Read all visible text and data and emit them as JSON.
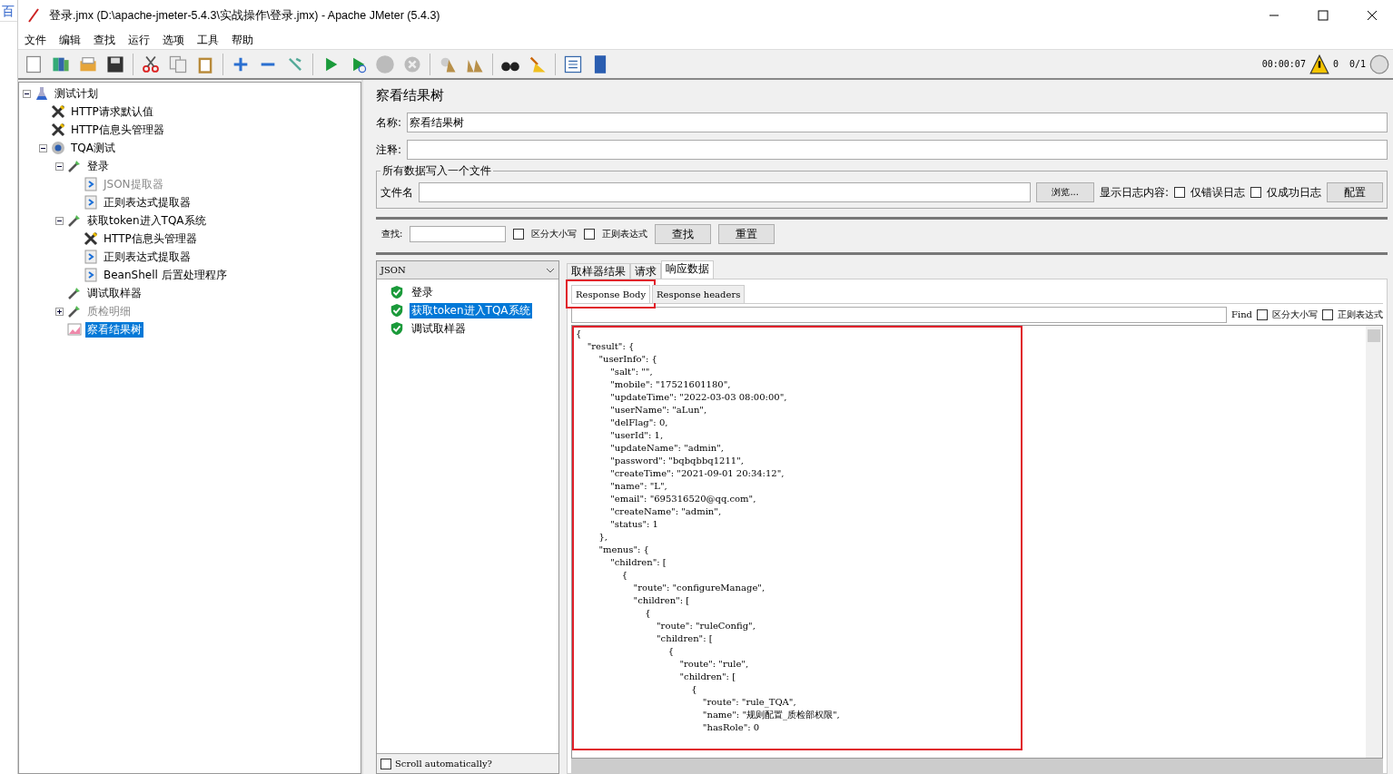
{
  "behind_window": {
    "text": "百"
  },
  "window": {
    "title": "登录.jmx (D:\\apache-jmeter-5.4.3\\实战操作\\登录.jmx) - Apache JMeter (5.4.3)"
  },
  "menu": [
    "文件",
    "编辑",
    "查找",
    "运行",
    "选项",
    "工具",
    "帮助"
  ],
  "status": {
    "elapsed": "00:00:07",
    "warnings": "0",
    "threads": "0/1"
  },
  "tree": [
    {
      "label": "测试计划",
      "kind": "plan",
      "disabled": false,
      "selected": false,
      "expanded": true,
      "children": [
        {
          "label": "HTTP请求默认值",
          "kind": "config",
          "disabled": false,
          "selected": false
        },
        {
          "label": "HTTP信息头管理器",
          "kind": "config",
          "disabled": false,
          "selected": false
        },
        {
          "label": "TQA测试",
          "kind": "group",
          "disabled": false,
          "selected": false,
          "expanded": true,
          "children": [
            {
              "label": "登录",
              "kind": "sampler",
              "disabled": false,
              "selected": false,
              "expanded": true,
              "children": [
                {
                  "label": "JSON提取器",
                  "kind": "post",
                  "disabled": true,
                  "selected": false
                },
                {
                  "label": "正则表达式提取器",
                  "kind": "post",
                  "disabled": false,
                  "selected": false
                }
              ]
            },
            {
              "label": "获取token进入TQA系统",
              "kind": "sampler",
              "disabled": false,
              "selected": false,
              "expanded": true,
              "children": [
                {
                  "label": "HTTP信息头管理器",
                  "kind": "config",
                  "disabled": false,
                  "selected": false
                },
                {
                  "label": "正则表达式提取器",
                  "kind": "post",
                  "disabled": false,
                  "selected": false
                },
                {
                  "label": "BeanShell 后置处理程序",
                  "kind": "post",
                  "disabled": false,
                  "selected": false
                }
              ]
            },
            {
              "label": "调试取样器",
              "kind": "sampler",
              "disabled": false,
              "selected": false
            },
            {
              "label": "质检明细",
              "kind": "sampler",
              "disabled": true,
              "selected": false,
              "expanded": false
            },
            {
              "label": "察看结果树",
              "kind": "listener",
              "disabled": false,
              "selected": true
            }
          ]
        }
      ]
    }
  ],
  "panel": {
    "title": "察看结果树",
    "name_label": "名称:",
    "name_value": "察看结果树",
    "comment_label": "注释:",
    "file_group": "所有数据写入一个文件",
    "file_label": "文件名",
    "browse": "浏览...",
    "log_label": "显示日志内容:",
    "log_options": [
      {
        "label": "仅错误日志",
        "checked": false
      },
      {
        "label": "仅成功日志",
        "checked": false
      }
    ],
    "config": "配置"
  },
  "search": {
    "label": "查找:",
    "options": [
      {
        "label": "区分大小写",
        "checked": false
      },
      {
        "label": "正则表达式",
        "checked": false
      }
    ],
    "find": "查找",
    "reset": "重置"
  },
  "results": {
    "renderer": "JSON",
    "items": [
      {
        "label": "登录",
        "selected": false
      },
      {
        "label": "获取token进入TQA系统",
        "selected": true
      },
      {
        "label": "调试取样器",
        "selected": false
      }
    ],
    "scroll": {
      "label": "Scroll automatically?",
      "checked": false
    }
  },
  "tabs": [
    {
      "label": "取样器结果",
      "selected": false
    },
    {
      "label": "请求",
      "selected": false
    },
    {
      "label": "响应数据",
      "selected": true
    }
  ],
  "subtabs": [
    {
      "label": "Response Body",
      "selected": true,
      "highlighted": true
    },
    {
      "label": "Response headers",
      "selected": false,
      "highlighted": false
    }
  ],
  "body_find": {
    "label": "Find",
    "options": [
      {
        "label": "区分大小写",
        "checked": false
      },
      {
        "label": "正则表达式",
        "checked": false
      }
    ]
  },
  "body": {
    "highlighted": true,
    "lines": [
      "{",
      "    \"result\": {",
      "        \"userInfo\": {",
      "            \"salt\": \"\",",
      "            \"mobile\": \"17521601180\",",
      "            \"updateTime\": \"2022-03-03 08:00:00\",",
      "            \"userName\": \"aLun\",",
      "            \"delFlag\": 0,",
      "            \"userId\": 1,",
      "            \"updateName\": \"admin\",",
      "            \"password\": \"bqbqbbq1211\",",
      "            \"createTime\": \"2021-09-01 20:34:12\",",
      "            \"name\": \"L\",",
      "            \"email\": \"695316520@qq.com\",",
      "            \"createName\": \"admin\",",
      "            \"status\": 1",
      "        },",
      "        \"menus\": {",
      "            \"children\": [",
      "                {",
      "                    \"route\": \"configureManage\",",
      "                    \"children\": [",
      "                        {",
      "                            \"route\": \"ruleConfig\",",
      "                            \"children\": [",
      "                                {",
      "                                    \"route\": \"rule\",",
      "                                    \"children\": [",
      "                                        {",
      "                                            \"route\": \"rule_TQA\",",
      "                                            \"name\": \"规则配置_质检部权限\",",
      "                                            \"hasRole\": 0"
    ]
  }
}
